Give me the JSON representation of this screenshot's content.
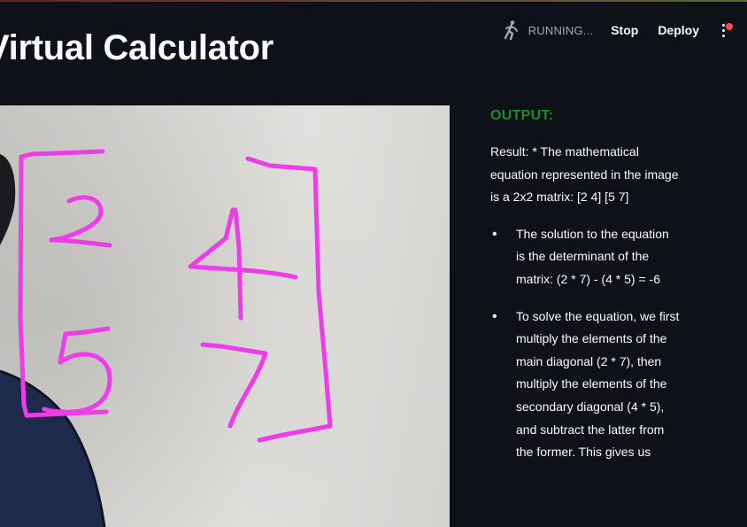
{
  "header": {
    "status_text": "RUNNING...",
    "stop_label": "Stop",
    "deploy_label": "Deploy",
    "notification_color": "#ff4b4b"
  },
  "page": {
    "title": "Virtual Calculator"
  },
  "output": {
    "heading": "OUTPUT:",
    "heading_color": "#1d8a2a",
    "result_text": "Result: * The mathematical equation represented in the image is a 2x2 matrix: [2 4] [5 7]",
    "bullets": [
      "The solution to the equation is the determinant of the matrix: (2 * 7) - (4 * 5) = -6",
      "To solve the equation, we first multiply the elements of the main diagonal (2 * 7), then multiply the elements of the secondary diagonal (4 * 5), and subtract the latter from the former. This gives us"
    ]
  },
  "canvas": {
    "stroke_color": "#ee3ce8"
  }
}
